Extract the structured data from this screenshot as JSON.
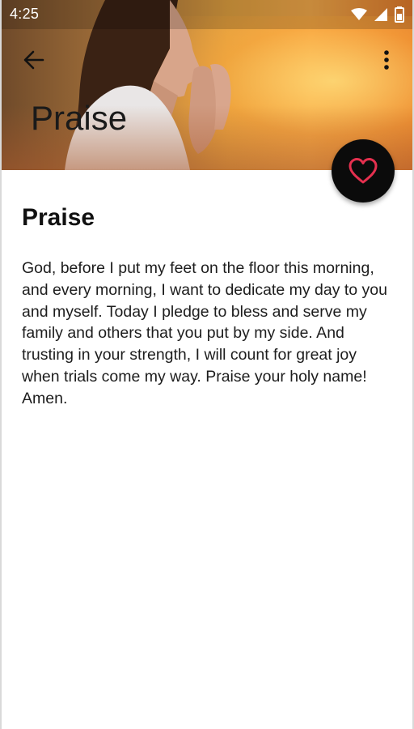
{
  "status_bar": {
    "time": "4:25",
    "icons": [
      "wifi-icon",
      "signal-icon",
      "battery-icon"
    ]
  },
  "toolbar": {
    "back_icon": "arrow-left-icon",
    "menu_icon": "more-vertical-icon"
  },
  "header": {
    "title": "Praise"
  },
  "favorite": {
    "icon": "heart-outline-icon",
    "color": "#e5304f"
  },
  "prayer": {
    "title": "Praise",
    "text": "God, before I put my feet on the floor this morning, and every morning, I want to dedicate my day to you and myself. Today I pledge to bless and serve my family and others that you put by my side. And trusting in your strength, I will count for great joy when trials come my way. Praise your holy name! Amen."
  },
  "colors": {
    "fab_background": "#0b0b0b",
    "title_text": "#111111"
  }
}
